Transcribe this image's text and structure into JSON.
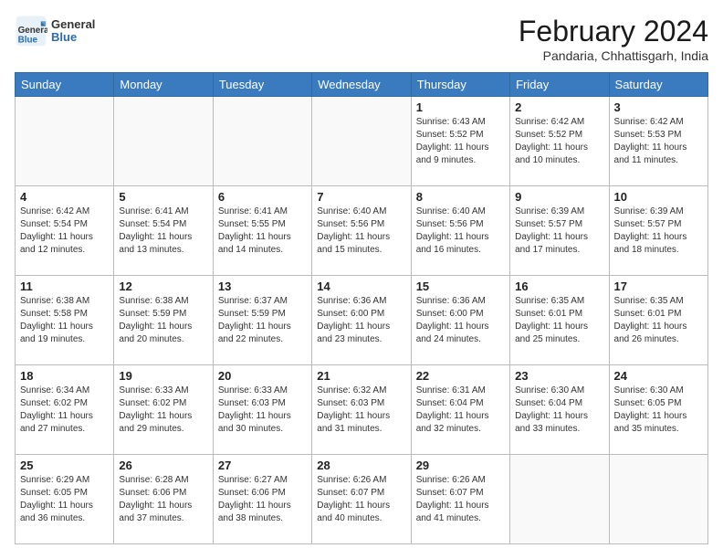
{
  "logo": {
    "general": "General",
    "blue": "Blue"
  },
  "header": {
    "month_year": "February 2024",
    "location": "Pandaria, Chhattisgarh, India"
  },
  "days_of_week": [
    "Sunday",
    "Monday",
    "Tuesday",
    "Wednesday",
    "Thursday",
    "Friday",
    "Saturday"
  ],
  "weeks": [
    [
      {
        "day": "",
        "info": ""
      },
      {
        "day": "",
        "info": ""
      },
      {
        "day": "",
        "info": ""
      },
      {
        "day": "",
        "info": ""
      },
      {
        "day": "1",
        "info": "Sunrise: 6:43 AM\nSunset: 5:52 PM\nDaylight: 11 hours and 9 minutes."
      },
      {
        "day": "2",
        "info": "Sunrise: 6:42 AM\nSunset: 5:52 PM\nDaylight: 11 hours and 10 minutes."
      },
      {
        "day": "3",
        "info": "Sunrise: 6:42 AM\nSunset: 5:53 PM\nDaylight: 11 hours and 11 minutes."
      }
    ],
    [
      {
        "day": "4",
        "info": "Sunrise: 6:42 AM\nSunset: 5:54 PM\nDaylight: 11 hours and 12 minutes."
      },
      {
        "day": "5",
        "info": "Sunrise: 6:41 AM\nSunset: 5:54 PM\nDaylight: 11 hours and 13 minutes."
      },
      {
        "day": "6",
        "info": "Sunrise: 6:41 AM\nSunset: 5:55 PM\nDaylight: 11 hours and 14 minutes."
      },
      {
        "day": "7",
        "info": "Sunrise: 6:40 AM\nSunset: 5:56 PM\nDaylight: 11 hours and 15 minutes."
      },
      {
        "day": "8",
        "info": "Sunrise: 6:40 AM\nSunset: 5:56 PM\nDaylight: 11 hours and 16 minutes."
      },
      {
        "day": "9",
        "info": "Sunrise: 6:39 AM\nSunset: 5:57 PM\nDaylight: 11 hours and 17 minutes."
      },
      {
        "day": "10",
        "info": "Sunrise: 6:39 AM\nSunset: 5:57 PM\nDaylight: 11 hours and 18 minutes."
      }
    ],
    [
      {
        "day": "11",
        "info": "Sunrise: 6:38 AM\nSunset: 5:58 PM\nDaylight: 11 hours and 19 minutes."
      },
      {
        "day": "12",
        "info": "Sunrise: 6:38 AM\nSunset: 5:59 PM\nDaylight: 11 hours and 20 minutes."
      },
      {
        "day": "13",
        "info": "Sunrise: 6:37 AM\nSunset: 5:59 PM\nDaylight: 11 hours and 22 minutes."
      },
      {
        "day": "14",
        "info": "Sunrise: 6:36 AM\nSunset: 6:00 PM\nDaylight: 11 hours and 23 minutes."
      },
      {
        "day": "15",
        "info": "Sunrise: 6:36 AM\nSunset: 6:00 PM\nDaylight: 11 hours and 24 minutes."
      },
      {
        "day": "16",
        "info": "Sunrise: 6:35 AM\nSunset: 6:01 PM\nDaylight: 11 hours and 25 minutes."
      },
      {
        "day": "17",
        "info": "Sunrise: 6:35 AM\nSunset: 6:01 PM\nDaylight: 11 hours and 26 minutes."
      }
    ],
    [
      {
        "day": "18",
        "info": "Sunrise: 6:34 AM\nSunset: 6:02 PM\nDaylight: 11 hours and 27 minutes."
      },
      {
        "day": "19",
        "info": "Sunrise: 6:33 AM\nSunset: 6:02 PM\nDaylight: 11 hours and 29 minutes."
      },
      {
        "day": "20",
        "info": "Sunrise: 6:33 AM\nSunset: 6:03 PM\nDaylight: 11 hours and 30 minutes."
      },
      {
        "day": "21",
        "info": "Sunrise: 6:32 AM\nSunset: 6:03 PM\nDaylight: 11 hours and 31 minutes."
      },
      {
        "day": "22",
        "info": "Sunrise: 6:31 AM\nSunset: 6:04 PM\nDaylight: 11 hours and 32 minutes."
      },
      {
        "day": "23",
        "info": "Sunrise: 6:30 AM\nSunset: 6:04 PM\nDaylight: 11 hours and 33 minutes."
      },
      {
        "day": "24",
        "info": "Sunrise: 6:30 AM\nSunset: 6:05 PM\nDaylight: 11 hours and 35 minutes."
      }
    ],
    [
      {
        "day": "25",
        "info": "Sunrise: 6:29 AM\nSunset: 6:05 PM\nDaylight: 11 hours and 36 minutes."
      },
      {
        "day": "26",
        "info": "Sunrise: 6:28 AM\nSunset: 6:06 PM\nDaylight: 11 hours and 37 minutes."
      },
      {
        "day": "27",
        "info": "Sunrise: 6:27 AM\nSunset: 6:06 PM\nDaylight: 11 hours and 38 minutes."
      },
      {
        "day": "28",
        "info": "Sunrise: 6:26 AM\nSunset: 6:07 PM\nDaylight: 11 hours and 40 minutes."
      },
      {
        "day": "29",
        "info": "Sunrise: 6:26 AM\nSunset: 6:07 PM\nDaylight: 11 hours and 41 minutes."
      },
      {
        "day": "",
        "info": ""
      },
      {
        "day": "",
        "info": ""
      }
    ]
  ]
}
